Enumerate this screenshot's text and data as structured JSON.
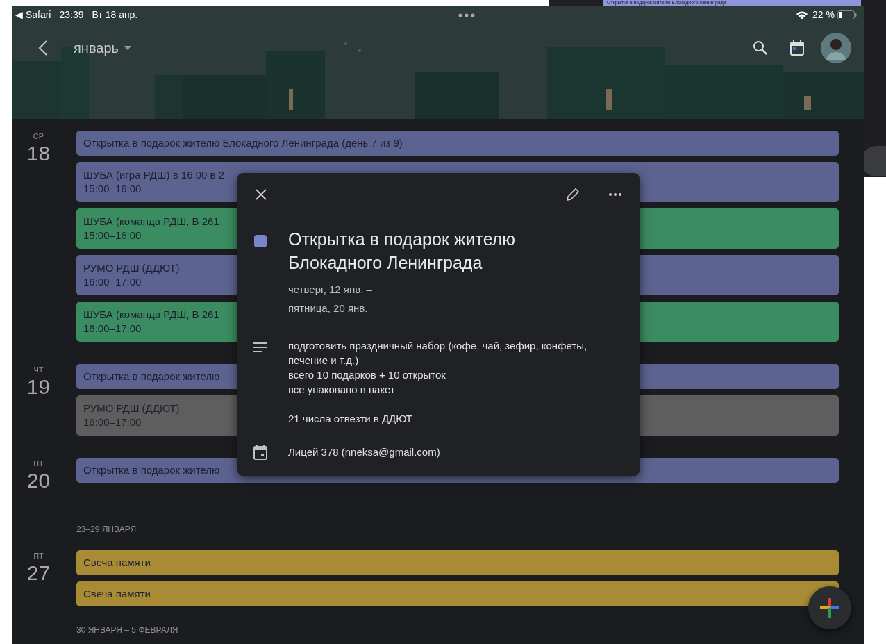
{
  "background_window": {
    "event_title": "Открытка в подарок жителю Блокадного Ленинграда"
  },
  "status_bar": {
    "back_app": "◀ Safari",
    "time": "23:39",
    "date": "Вт 18 апр.",
    "battery": "22 %"
  },
  "header": {
    "month": "январь"
  },
  "agenda": [
    {
      "kind": "day",
      "weekday": "СР",
      "day": "18",
      "events": [
        {
          "title": "Открытка в подарок жителю Блокадного Ленинграда  (день 7 из 9)",
          "color": "#5c6391"
        },
        {
          "title": "ШУБА (игра РДШ) в 16:00 в 2",
          "time": "15:00–16:00",
          "color": "#5c6391"
        },
        {
          "title": "ШУБА (команда РДШ, В 261",
          "time": "15:00–16:00",
          "color": "#3b8c60"
        },
        {
          "title": "РУМО РДШ (ДДЮТ)",
          "time": "16:00–17:00",
          "color": "#5c6391"
        },
        {
          "title": "ШУБА (команда РДШ, В 261",
          "time": "16:00–17:00",
          "color": "#3b8c60"
        }
      ]
    },
    {
      "kind": "day",
      "weekday": "ЧТ",
      "day": "19",
      "events": [
        {
          "title": "Открытка в подарок жителю",
          "color": "#5c6391"
        },
        {
          "title": "РУМО РДШ (ДДЮТ)",
          "time": "16:00–17:00",
          "color": "#5e5e5e"
        }
      ]
    },
    {
      "kind": "day",
      "weekday": "ПТ",
      "day": "20",
      "events": [
        {
          "title": "Открытка в подарок жителю",
          "color": "#5c6391"
        }
      ]
    },
    {
      "kind": "week",
      "label": "23–29 ЯНВАРЯ"
    },
    {
      "kind": "day",
      "weekday": "ПТ",
      "day": "27",
      "events": [
        {
          "title": "Свеча памяти",
          "color": "#a98a35"
        },
        {
          "title": "Свеча памяти",
          "color": "#a98a35"
        }
      ]
    },
    {
      "kind": "week",
      "label": "30 ЯНВАРЯ – 5 ФЕВРАЛЯ"
    }
  ],
  "event_popup": {
    "color": "#7986cb",
    "title": "Открытка в подарок жителю Блокадного Ленинграда",
    "date_lines": [
      "четверг, 12 янв. –",
      "пятница, 20 янв."
    ],
    "description": [
      "подготовить праздничный набор (кофе, чай, зефир, конфеты, печение и т.д.)",
      "всего 10 подарков + 10 открыток",
      "все упаковано в пакет"
    ],
    "note": "21 числа отвезти в ДДЮТ",
    "calendar": "Лицей 378 (nneksa@gmail.com)"
  }
}
